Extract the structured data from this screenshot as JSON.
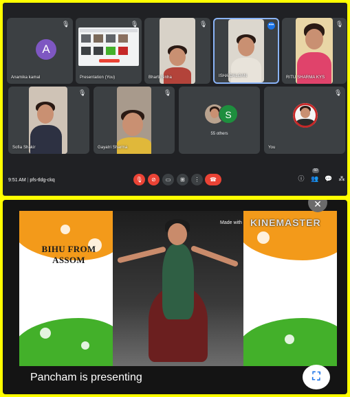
{
  "call": {
    "participants": [
      {
        "name": "Anamika kamal",
        "initial": "A"
      },
      {
        "name": "Presentation (You)"
      },
      {
        "name": "Bharti Sinha"
      },
      {
        "name": "ISHA DALGAN"
      },
      {
        "name": "RITU SHARMA KYS"
      },
      {
        "name": "Sofia Shakir"
      },
      {
        "name": "Gayatri Sharma"
      },
      {
        "name": "55 others",
        "initial": "S"
      },
      {
        "name": "You"
      }
    ],
    "time": "9:51 AM",
    "meeting_code": "pfs-tldg-ckq",
    "people_count": "60"
  },
  "video": {
    "overlay_title": "BIHU FROM ASSOM",
    "watermark_prefix": "Made with",
    "watermark_brand": "KINEMASTER",
    "presenting_text": "Pancham is presenting"
  },
  "colors": {
    "page_background": "#ffff00",
    "call_background": "#202124",
    "tile_background": "#3c4043",
    "end_call_red": "#ea4335",
    "active_speaker_blue": "#8ab4f8",
    "saffron": "#f39a1a",
    "green": "#43b02a"
  }
}
